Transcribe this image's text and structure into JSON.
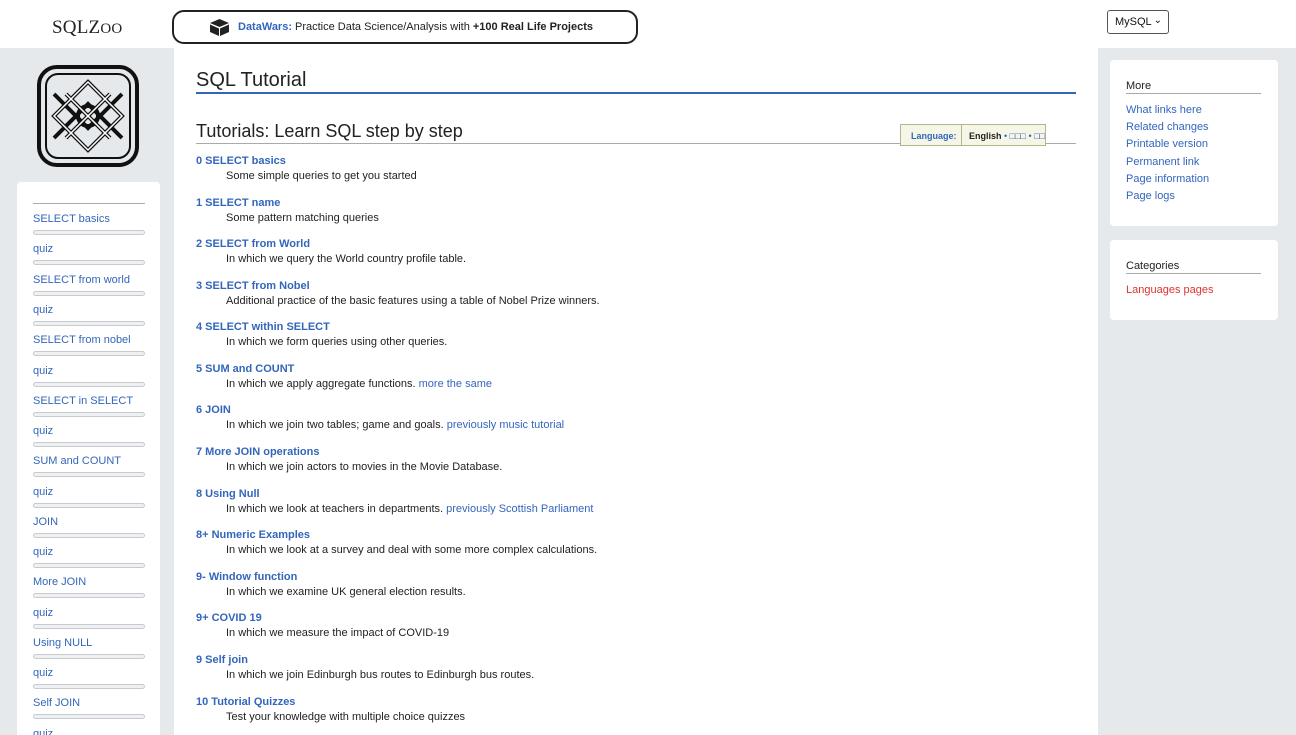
{
  "header": {
    "site_title_a": "SQLZ",
    "site_title_b": "OO",
    "promo_brand": "DataWars:",
    "promo_text": "Practice Data Science/Analysis with",
    "promo_strong": "+100 Real Life Projects",
    "dialect_selected": "MySQL"
  },
  "sidebar": {
    "items": [
      {
        "label": "SELECT basics"
      },
      {
        "label": "quiz"
      },
      {
        "label": "SELECT from world"
      },
      {
        "label": "quiz"
      },
      {
        "label": "SELECT from nobel"
      },
      {
        "label": "quiz"
      },
      {
        "label": "SELECT in SELECT"
      },
      {
        "label": "quiz"
      },
      {
        "label": "SUM and COUNT"
      },
      {
        "label": "quiz"
      },
      {
        "label": "JOIN"
      },
      {
        "label": "quiz"
      },
      {
        "label": "More JOIN"
      },
      {
        "label": "quiz"
      },
      {
        "label": "Using NULL"
      },
      {
        "label": "quiz"
      },
      {
        "label": "Self JOIN"
      },
      {
        "label": "quiz"
      }
    ]
  },
  "main": {
    "page_title": "SQL Tutorial",
    "subtitle": "Tutorials: Learn SQL step by step",
    "language_label": "Language:",
    "language_value": "English",
    "language_alt": "• □□□ • □□",
    "tutorials": [
      {
        "title": "0 SELECT basics",
        "desc": "Some simple queries to get you started",
        "extra": ""
      },
      {
        "title": "1 SELECT name",
        "desc": "Some pattern matching queries",
        "extra": ""
      },
      {
        "title": "2 SELECT from World",
        "desc": "In which we query the World country profile table.",
        "extra": ""
      },
      {
        "title": "3 SELECT from Nobel",
        "desc": "Additional practice of the basic features using a table of Nobel Prize winners.",
        "extra": ""
      },
      {
        "title": "4 SELECT within SELECT",
        "desc": "In which we form queries using other queries.",
        "extra": ""
      },
      {
        "title": "5 SUM and COUNT",
        "desc": "In which we apply aggregate functions.",
        "extra": "more the same"
      },
      {
        "title": "6 JOIN",
        "desc": "In which we join two tables; game and goals.",
        "extra": "previously music tutorial"
      },
      {
        "title": "7 More JOIN operations",
        "desc": "In which we join actors to movies in the Movie Database.",
        "extra": ""
      },
      {
        "title": "8 Using Null",
        "desc": "In which we look at teachers in departments.",
        "extra": "previously Scottish Parliament"
      },
      {
        "title": "8+ Numeric Examples",
        "desc": "In which we look at a survey and deal with some more complex calculations.",
        "extra": ""
      },
      {
        "title": "9- Window function",
        "desc": "In which we examine UK general election results.",
        "extra": ""
      },
      {
        "title": "9+ COVID 19",
        "desc": "In which we measure the impact of COVID-19",
        "extra": ""
      },
      {
        "title": "9 Self join",
        "desc": "In which we join Edinburgh bus routes to Edinburgh bus routes.",
        "extra": ""
      },
      {
        "title": "10 Tutorial Quizzes",
        "desc": "Test your knowledge with multiple choice quizzes",
        "extra": ""
      }
    ]
  },
  "right": {
    "more_heading": "More",
    "more_links": [
      "What links here",
      "Related changes",
      "Printable version",
      "Permanent link",
      "Page information",
      "Page logs"
    ],
    "categories_heading": "Categories",
    "categories_links": [
      "Languages pages"
    ]
  },
  "colors": {
    "link": "#3366bb",
    "redlink": "#dd3333",
    "page_bg": "#e6e9ec"
  }
}
